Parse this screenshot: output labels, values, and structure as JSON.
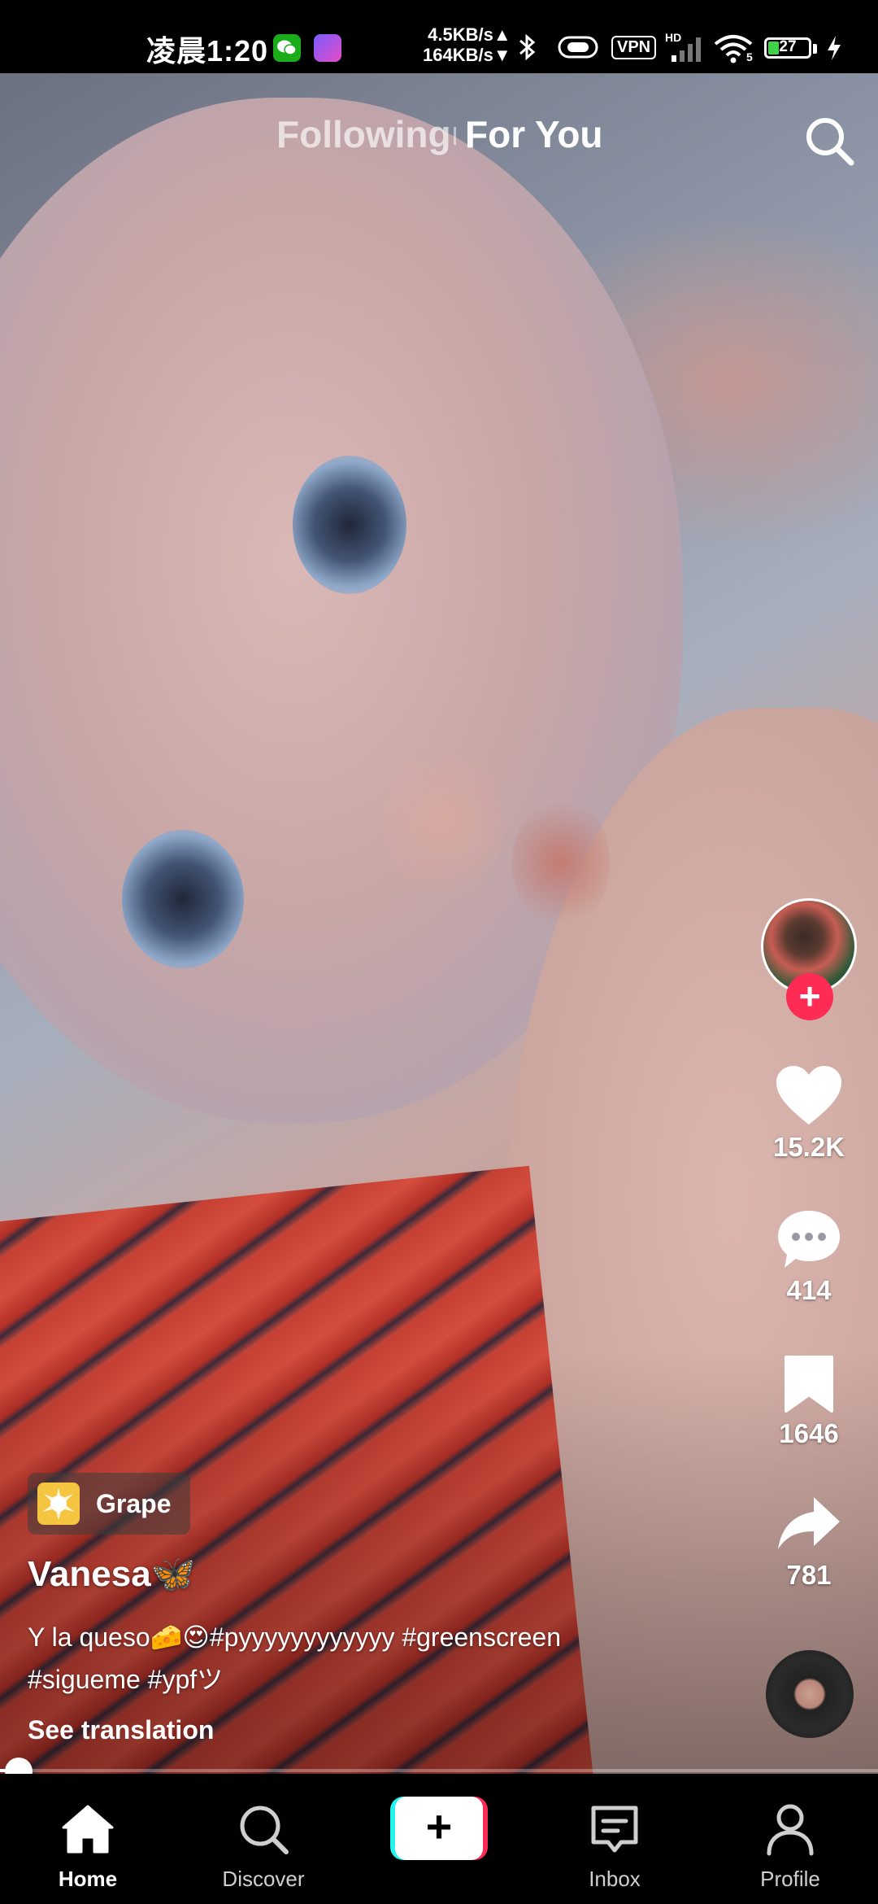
{
  "status_bar": {
    "time": "凌晨1:20",
    "net_up": "4.5KB/s▲",
    "net_down": "164KB/s▼",
    "vpn": "VPN",
    "hd": "HD",
    "wifi_level": "5",
    "battery": "27",
    "battery_level": 0.27,
    "app_icons": [
      "wechat-icon",
      "app-icon"
    ]
  },
  "top_tabs": {
    "following": "Following",
    "for_you": "For You",
    "active": "For You"
  },
  "rail": {
    "likes": "15.2K",
    "comments": "414",
    "saves": "1646",
    "shares": "781"
  },
  "effect": {
    "label": "Grape"
  },
  "post": {
    "username": "Vanesa🦋",
    "caption_line1": "Y la queso🧀😍#pyyyyyyyyyyyy #greenscreen",
    "caption_line2": "#sigueme #ypfツ",
    "see_translation": "See translation"
  },
  "progress": {
    "value": 0.01
  },
  "nav": {
    "home": "Home",
    "discover": "Discover",
    "inbox": "Inbox",
    "profile": "Profile",
    "create_symbol": "+",
    "active": "Home"
  },
  "colors": {
    "accent_red": "#fe2c55",
    "accent_cyan": "#25f4ee",
    "battery_green": "#3fd14a"
  }
}
